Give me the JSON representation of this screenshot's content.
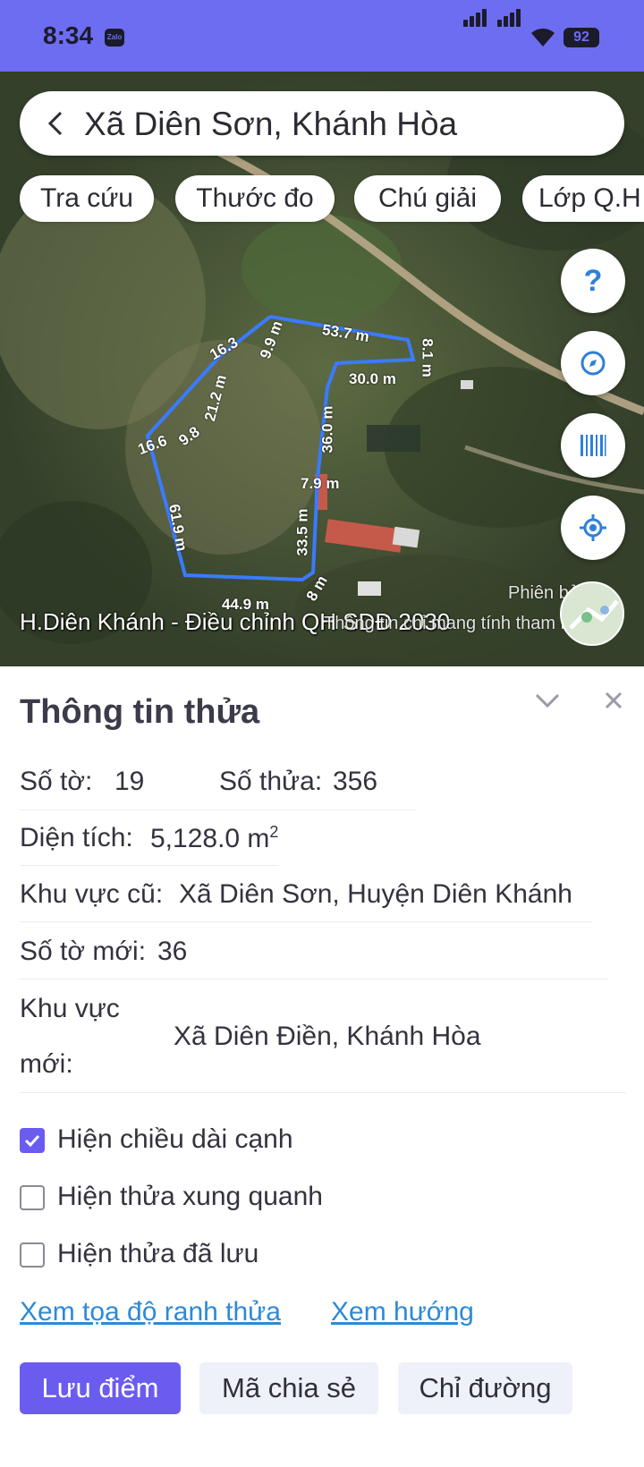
{
  "status_bar": {
    "time": "8:34",
    "notification_app": "Zalo",
    "battery": "92",
    "icons": [
      "signal-icon",
      "signal-icon",
      "wifi-icon",
      "battery-icon"
    ]
  },
  "search": {
    "title": "Xã Diên Sơn, Khánh Hòa"
  },
  "chips": [
    "Tra cứu",
    "Thước đo",
    "Chú giải",
    "Lớp Q.H"
  ],
  "map": {
    "edge_labels": [
      "53.7 m",
      "8.1 m",
      "30.0 m",
      "36.0 m",
      "7.9 m",
      "33.5 m",
      "8 m",
      "44.9 m",
      "61.9 m",
      "16.6",
      "9.8",
      "21.2 m",
      "16.3",
      "9.9 m"
    ],
    "caption": "H.Diên Khánh - Điều chỉnh QH SDĐ 2030",
    "caption2": "Thông tin chỉ mang tính tham khảo",
    "version": "Phiên bản 1",
    "parcel_color": "#3a7bff",
    "fab_icons": [
      "help-icon",
      "compass-icon",
      "barcode-icon",
      "locate-icon"
    ]
  },
  "panel": {
    "title": "Thông tin thửa",
    "so_to_label": "Số tờ:",
    "so_to_value": "19",
    "so_thua_label": "Số thửa:",
    "so_thua_value": "356",
    "dien_tich_label": "Diện tích:",
    "dien_tich_value": "5,128.0 m",
    "dien_tich_unit_sup": "2",
    "khu_vuc_cu_label": "Khu vực cũ:",
    "khu_vuc_cu_value": "Xã Diên Sơn, Huyện Diên Khánh",
    "so_to_moi_label": "Số tờ mới:",
    "so_to_moi_value": "36",
    "khu_vuc_moi_label_1": "Khu vực",
    "khu_vuc_moi_label_2": "mới:",
    "khu_vuc_moi_value": "Xã Diên Điền, Khánh Hòa",
    "checkboxes": [
      {
        "label": "Hiện chiều dài cạnh",
        "checked": true
      },
      {
        "label": "Hiện thửa xung quanh",
        "checked": false
      },
      {
        "label": "Hiện thửa đã lưu",
        "checked": false
      }
    ],
    "links": {
      "coords": "Xem tọa độ ranh thửa",
      "direction": "Xem hướng"
    },
    "buttons": {
      "save": "Lưu điểm",
      "share": "Mã chia sẻ",
      "route": "Chỉ đường"
    },
    "accent_color": "#6b5cf0"
  }
}
